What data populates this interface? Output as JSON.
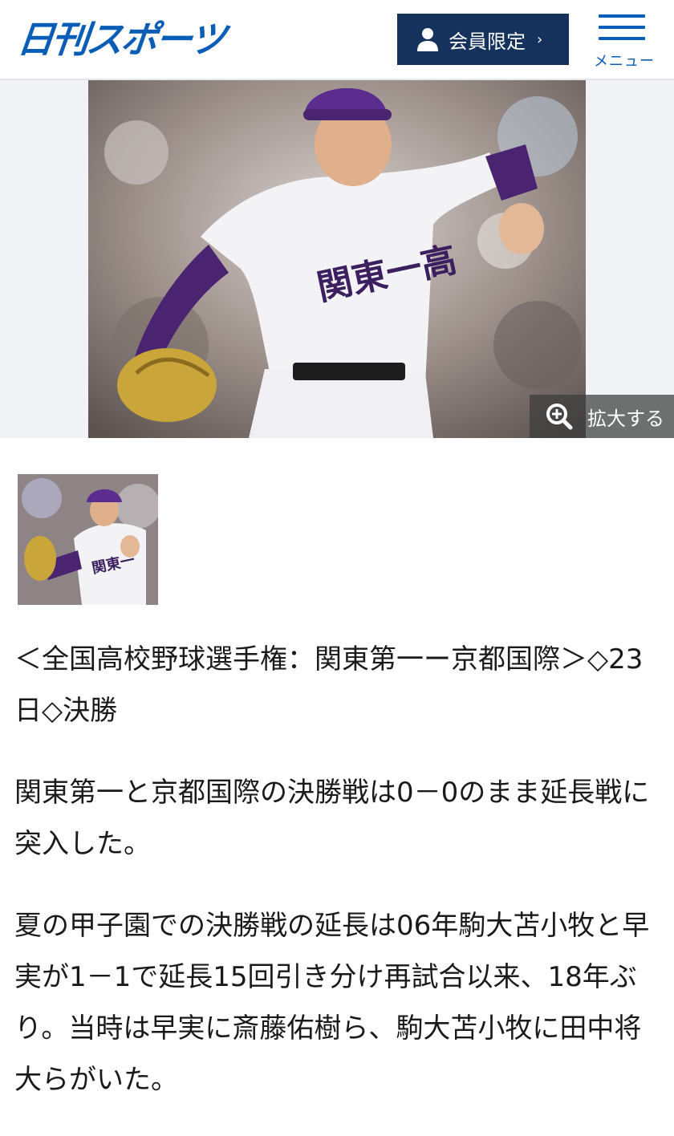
{
  "header": {
    "logo_text": "日刊スポーツ",
    "member_button_label": "会員限定",
    "member_button_chevron": "›",
    "menu_label": "メニュー"
  },
  "hero": {
    "zoom_label": "拡大する"
  },
  "article": {
    "lead": "＜全国高校野球選手権：関東第一ー京都国際＞◇23日◇決勝",
    "paragraphs": [
      "関東第一と京都国際の決勝戦は0－0のまま延長戦に突入した。",
      "夏の甲子園での決勝戦の延長は06年駒大苫小牧と早実が1－1で延長15回引き分け再試合以来、18年ぶり。当時は早実に斎藤佑樹ら、駒大苫小牧に田中将大らがいた。"
    ]
  },
  "colors": {
    "brand_blue": "#0a5db7",
    "member_navy": "#14325c",
    "uniform_lettering": "#3b1f5e",
    "cap_purple": "#5b2d8e"
  },
  "icons": [
    "person-icon",
    "chevron-right-icon",
    "hamburger-menu-icon",
    "zoom-in-icon"
  ]
}
